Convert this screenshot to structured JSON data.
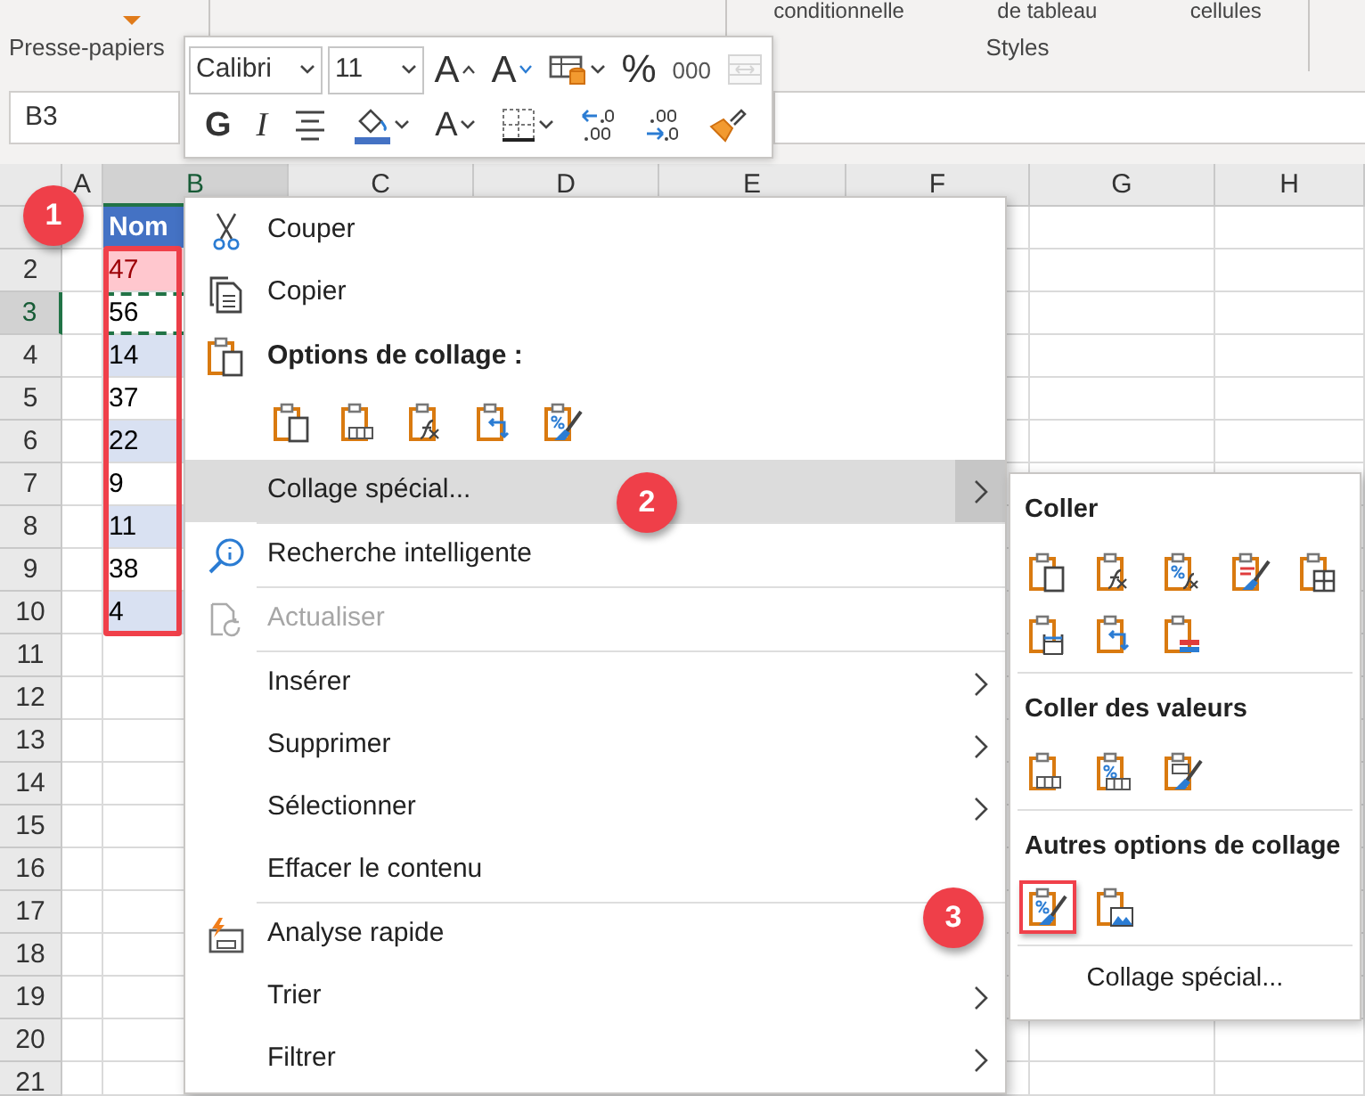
{
  "ribbon": {
    "groups": [
      {
        "label": "Presse-papiers"
      },
      {
        "label": "Styles",
        "buttons": [
          "conditionnelle",
          "de tableau",
          "cellules"
        ]
      }
    ]
  },
  "name_box": {
    "value": "B3"
  },
  "mini_toolbar": {
    "upper_row": [
      {
        "kind": "font",
        "value": "Calibri",
        "disabled": false
      },
      {
        "kind": "size",
        "value": "11",
        "disabled": false
      },
      {
        "kind": "grow",
        "label": "A",
        "disabled": false
      },
      {
        "kind": "shrink",
        "label": "A",
        "disabled": false
      },
      {
        "kind": "table-format",
        "disabled": false
      },
      {
        "kind": "percent",
        "label": "%",
        "disabled": false
      },
      {
        "kind": "thousands",
        "label": "000",
        "disabled": false
      },
      {
        "kind": "merge",
        "disabled": true
      }
    ],
    "lower_row": [
      {
        "kind": "bold",
        "label": "G",
        "disabled": false
      },
      {
        "kind": "italic",
        "label": "I",
        "disabled": false
      },
      {
        "kind": "align",
        "disabled": false
      },
      {
        "kind": "fill",
        "disabled": false
      },
      {
        "kind": "font-color",
        "label": "A",
        "disabled": false
      },
      {
        "kind": "borders",
        "disabled": false
      },
      {
        "kind": "decrease-decimal",
        "disabled": false
      },
      {
        "kind": "increase-decimal",
        "disabled": false
      },
      {
        "kind": "painter",
        "disabled": false
      }
    ]
  },
  "sheet": {
    "columns": [
      {
        "label": "A",
        "selected": false
      },
      {
        "label": "B",
        "selected": true
      },
      {
        "label": "C",
        "selected": false
      },
      {
        "label": "D",
        "selected": false
      },
      {
        "label": "E",
        "selected": false
      },
      {
        "label": "F",
        "selected": false
      },
      {
        "label": "G",
        "selected": false
      },
      {
        "label": "H",
        "selected": false
      }
    ],
    "rows": [
      {
        "selected": false
      },
      {
        "label": "2",
        "selected": false
      },
      {
        "label": "3",
        "selected": true
      },
      {
        "label": "4",
        "selected": false
      },
      {
        "label": "5",
        "selected": false
      },
      {
        "label": "6",
        "selected": false
      },
      {
        "label": "7",
        "selected": false
      },
      {
        "label": "8",
        "selected": false
      },
      {
        "label": "9",
        "selected": false
      },
      {
        "label": "10",
        "selected": false
      },
      {
        "label": "11",
        "selected": false
      },
      {
        "label": "12",
        "selected": false
      },
      {
        "label": "13",
        "selected": false
      },
      {
        "label": "14",
        "selected": false
      },
      {
        "label": "15",
        "selected": false
      },
      {
        "label": "16",
        "selected": false
      },
      {
        "label": "17",
        "selected": false
      },
      {
        "label": "18",
        "selected": false
      },
      {
        "label": "19",
        "selected": false
      },
      {
        "label": "20",
        "selected": false
      },
      {
        "label": "21",
        "selected": false
      }
    ],
    "column_b": {
      "cells_above": [
        {
          "text": "Nom",
          "kind": "header",
          "copied": false
        }
      ],
      "highlighted_cells": [
        {
          "text": "47",
          "kind": "bad",
          "copied": false
        },
        {
          "text": "56",
          "kind": "plain",
          "copied": true
        },
        {
          "text": "14",
          "kind": "band",
          "copied": false
        },
        {
          "text": "37",
          "kind": "plain",
          "copied": false
        },
        {
          "text": "22",
          "kind": "band",
          "copied": false
        },
        {
          "text": "9",
          "kind": "plain",
          "copied": false
        },
        {
          "text": "11",
          "kind": "band",
          "copied": false
        },
        {
          "text": "38",
          "kind": "plain",
          "copied": false
        },
        {
          "text": "4",
          "kind": "band",
          "copied": false
        }
      ]
    }
  },
  "context_menu": {
    "items": [
      {
        "kind": "command",
        "label": "Couper",
        "selected": false,
        "disabled": false,
        "submenu": false
      },
      {
        "kind": "command",
        "label": "Copier",
        "selected": false,
        "disabled": false,
        "submenu": false
      },
      {
        "kind": "header",
        "label": "Options de collage :"
      },
      {
        "kind": "icons",
        "icons": [
          {
            "kind": "paste"
          },
          {
            "kind": "values"
          },
          {
            "kind": "formulas"
          },
          {
            "kind": "transpose"
          },
          {
            "kind": "formatting"
          }
        ]
      },
      {
        "kind": "command",
        "label": "Collage spécial...",
        "selected": true,
        "disabled": false,
        "submenu": true
      },
      {
        "kind": "separator"
      },
      {
        "kind": "command",
        "label": "Recherche intelligente",
        "selected": false,
        "disabled": false,
        "submenu": false
      },
      {
        "kind": "separator"
      },
      {
        "kind": "command",
        "label": "Actualiser",
        "selected": false,
        "disabled": true,
        "submenu": false
      },
      {
        "kind": "separator"
      },
      {
        "kind": "command",
        "label": "Insérer",
        "selected": false,
        "disabled": false,
        "submenu": true
      },
      {
        "kind": "command",
        "label": "Supprimer",
        "selected": false,
        "disabled": false,
        "submenu": true
      },
      {
        "kind": "command",
        "label": "Sélectionner",
        "selected": false,
        "disabled": false,
        "submenu": true
      },
      {
        "kind": "command",
        "label": "Effacer le contenu",
        "selected": false,
        "disabled": false,
        "submenu": false
      },
      {
        "kind": "separator"
      },
      {
        "kind": "command",
        "label": "Analyse rapide",
        "selected": false,
        "disabled": false,
        "submenu": false
      },
      {
        "kind": "command",
        "label": "Trier",
        "selected": false,
        "disabled": false,
        "submenu": true
      },
      {
        "kind": "command",
        "label": "Filtrer",
        "selected": false,
        "disabled": false,
        "submenu": true
      }
    ]
  },
  "submenu": {
    "sections": [
      {
        "title": "Coller",
        "icons": [
          {
            "kind": "paste",
            "outlined": false
          },
          {
            "kind": "formulas",
            "outlined": false
          },
          {
            "kind": "formulas-number",
            "outlined": false
          },
          {
            "kind": "keep-source",
            "outlined": false
          },
          {
            "kind": "borderless",
            "outlined": false
          },
          {
            "kind": "column-widths",
            "outlined": false
          },
          {
            "kind": "transpose",
            "outlined": false
          },
          {
            "kind": "linked",
            "outlined": false
          }
        ]
      },
      {
        "title": "Coller des valeurs",
        "icons": [
          {
            "kind": "values",
            "outlined": false
          },
          {
            "kind": "values-number",
            "outlined": false
          },
          {
            "kind": "values-source",
            "outlined": false
          }
        ]
      },
      {
        "title": "Autres options de collage",
        "icons": [
          {
            "kind": "formatting",
            "outlined": true
          },
          {
            "kind": "picture",
            "outlined": false
          }
        ]
      }
    ],
    "footer": "Collage spécial..."
  },
  "callouts": [
    "1",
    "2",
    "3"
  ]
}
